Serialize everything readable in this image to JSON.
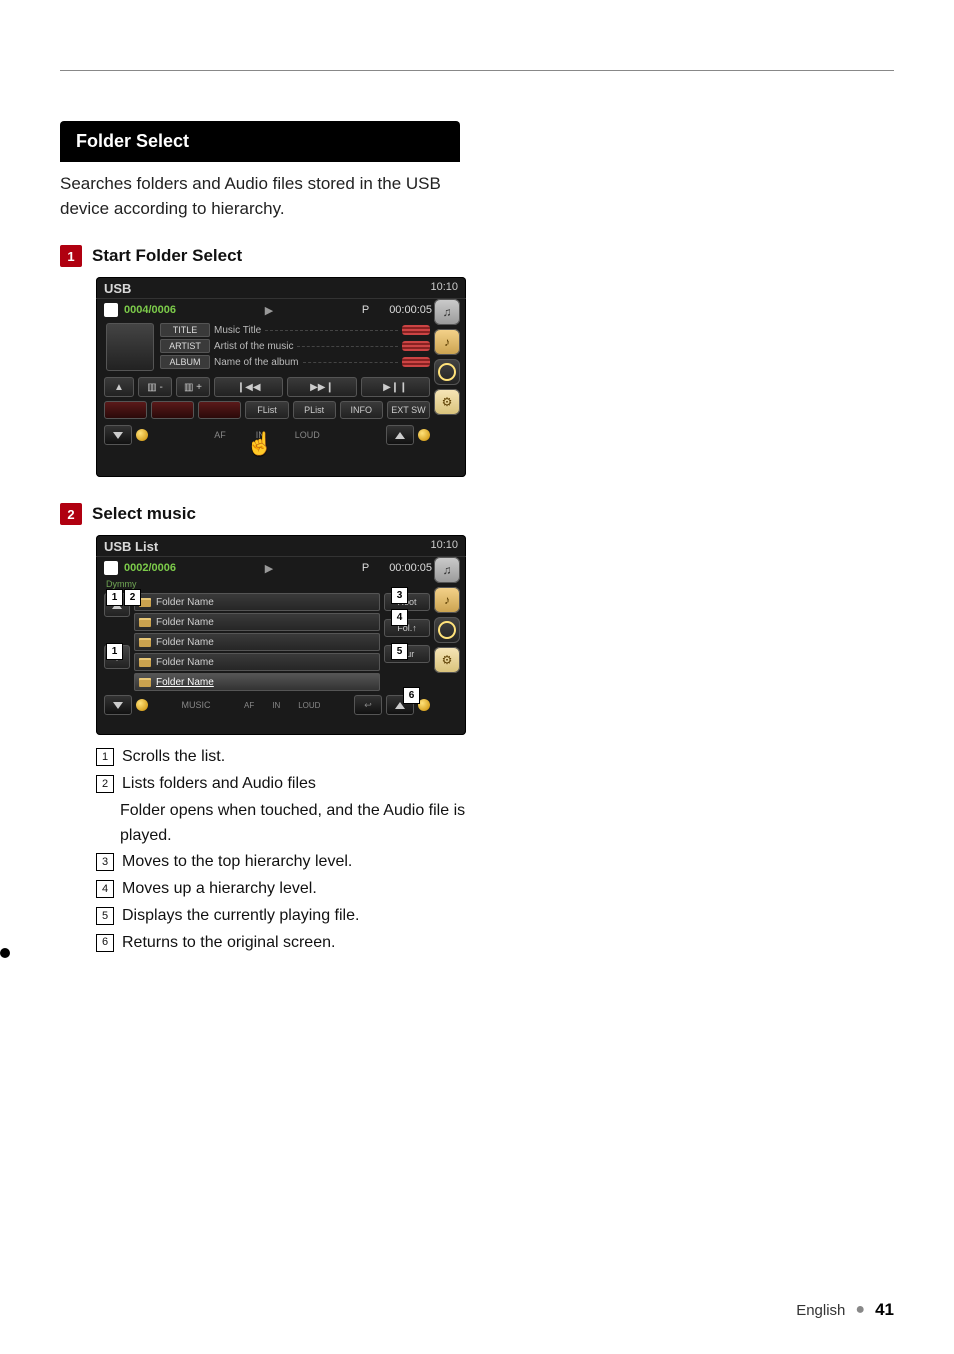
{
  "page": {
    "lang": "English",
    "number": "41"
  },
  "section": {
    "title": "Folder Select",
    "desc": "Searches folders and Audio files stored in the USB device according to hierarchy."
  },
  "steps": {
    "s1": {
      "num": "1",
      "title": "Start Folder Select"
    },
    "s2": {
      "num": "2",
      "title": "Select music"
    }
  },
  "shot1": {
    "header": "USB",
    "clock": "10:10",
    "track": "0004/0006",
    "play_sym": "▶",
    "p_label": "P",
    "time": "00:00:05",
    "meta": {
      "title_tag": "TITLE",
      "title_text": "Music Title",
      "artist_tag": "ARTIST",
      "artist_text": "Artist of the music",
      "album_tag": "ALBUM",
      "album_text": "Name of the album"
    },
    "row1": {
      "b1": "▲",
      "b2": "▥ -",
      "b3": "▥ +",
      "b4": "❙◀◀",
      "b5": "▶▶❙",
      "b6": "▶❙❙"
    },
    "row2": {
      "b1": "FList",
      "b2": "PList",
      "b3": "INFO",
      "b4": "EXT SW"
    },
    "foot": {
      "af": "AF",
      "in": "IN",
      "loud": "LOUD"
    }
  },
  "shot2": {
    "header": "USB List",
    "clock": "10:10",
    "track": "0002/0006",
    "play_sym": "▶",
    "p_label": "P",
    "time": "00:00:05",
    "crumb": "Dymmy",
    "folders": [
      "Folder Name",
      "Folder Name",
      "Folder Name",
      "Folder Name",
      "Folder Name"
    ],
    "right": {
      "root": "Root",
      "up": "Fol.↑",
      "cur": "Cur"
    },
    "foot": {
      "music": "MUSIC",
      "af": "AF",
      "in": "IN",
      "loud": "LOUD"
    },
    "callouts": {
      "c1": "1",
      "c2": "2",
      "c3": "3",
      "c4": "4",
      "c5": "5",
      "c6": "6"
    }
  },
  "legend": {
    "i1": "Scrolls the list.",
    "i2a": "Lists folders and Audio files",
    "i2b": "Folder opens when touched, and the Audio file is played.",
    "i3": "Moves to the top hierarchy level.",
    "i4": "Moves up a hierarchy level.",
    "i5": "Displays the currently playing file.",
    "i6": "Returns to the original screen."
  }
}
